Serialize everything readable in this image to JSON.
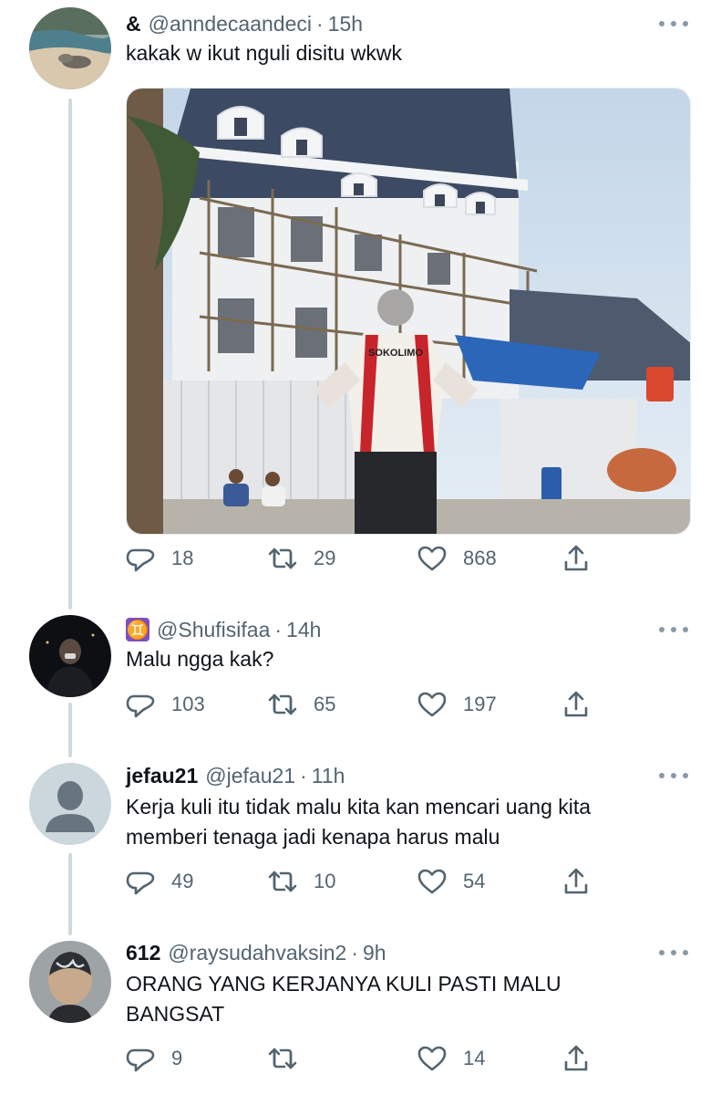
{
  "tweets": [
    {
      "display_name": "&",
      "handle": "@anndecaandeci",
      "time": "15h",
      "text": "kakak w ikut nguli disitu wkwk",
      "replies": "18",
      "retweets": "29",
      "likes": "868",
      "avatar": "beach-photo",
      "image": {
        "description": "construction-site-photo",
        "shirt_text": "SOKOLIMO"
      }
    },
    {
      "display_name": "♊",
      "handle": "@Shufisifaa",
      "time": "14h",
      "text": "Malu ngga kak?",
      "replies": "103",
      "retweets": "65",
      "likes": "197",
      "avatar": "dark-portrait"
    },
    {
      "display_name": "jefau21",
      "handle": "@jefau21",
      "time": "11h",
      "text_lines": [
        "Kerja kuli itu tidak malu kita kan mencari uang kita",
        "memberi tenaga jadi kenapa harus malu"
      ],
      "replies": "49",
      "retweets": "10",
      "likes": "54",
      "avatar": "default-profile"
    },
    {
      "display_name": "612",
      "handle": "@raysudahvaksin2",
      "time": "9h",
      "text_lines": [
        "ORANG YANG KERJANYA KULI PASTI MALU",
        "BANGSAT"
      ],
      "replies": "9",
      "retweets": "",
      "likes": "14",
      "avatar": "hair-art-photo"
    }
  ],
  "colors": {
    "text": "#0f1419",
    "secondary": "#536471",
    "thread_line": "#cfd9de",
    "sky": "#cfe0ef",
    "roof": "#3d4a63"
  }
}
